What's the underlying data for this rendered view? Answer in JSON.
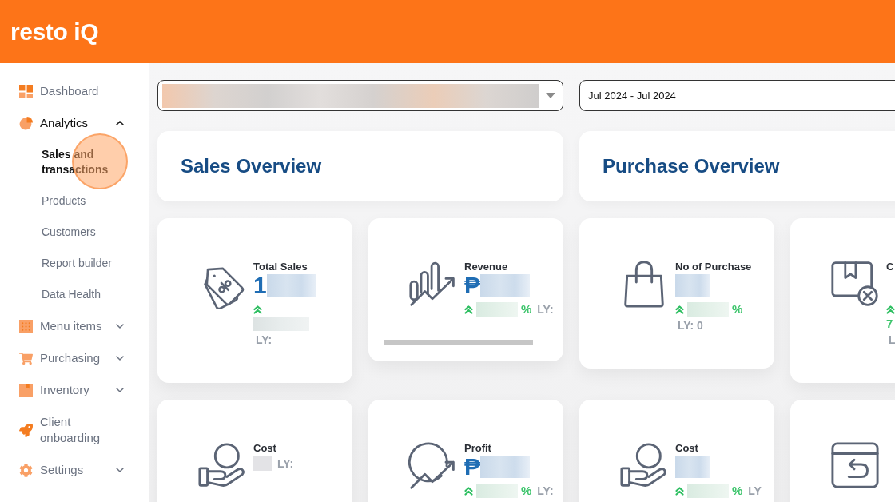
{
  "header": {
    "logo": "resto iQ"
  },
  "sidebar": {
    "items": [
      {
        "kind": "link",
        "label": "Dashboard",
        "selected": false
      },
      {
        "kind": "group",
        "label": "Analytics",
        "selected": true,
        "expanded": true,
        "children": [
          {
            "label": "Sales and transactions",
            "selected": true
          },
          {
            "label": "Products",
            "selected": false
          },
          {
            "label": "Customers",
            "selected": false
          },
          {
            "label": "Report builder",
            "selected": false
          },
          {
            "label": "Data Health",
            "selected": false
          }
        ]
      },
      {
        "kind": "group",
        "label": "Menu items",
        "selected": false,
        "expanded": false
      },
      {
        "kind": "group",
        "label": "Purchasing",
        "selected": false,
        "expanded": false
      },
      {
        "kind": "group",
        "label": "Inventory",
        "selected": false,
        "expanded": false
      },
      {
        "kind": "link",
        "label": "Client onboarding",
        "selected": false
      },
      {
        "kind": "group",
        "label": "Settings",
        "selected": false,
        "expanded": false
      }
    ]
  },
  "filters": {
    "store": {
      "redacted": true
    },
    "date_range": {
      "value": "Jul 2024 - Jul 2024"
    }
  },
  "sections": [
    {
      "title": "Sales Overview"
    },
    {
      "title": "Purchase Overview"
    }
  ],
  "kpi_cards": [
    {
      "title": "Total Sales",
      "scrollbar": false,
      "lines": [
        {
          "kind": "value",
          "text": "1",
          "blurred": true
        },
        {
          "kind": "change",
          "up": true,
          "blurred": false
        },
        {
          "kind": "percent",
          "blurred": true
        },
        {
          "kind": "ly",
          "text": "LY:",
          "blurred": false
        }
      ]
    },
    {
      "title": "Revenue",
      "scrollbar": true,
      "lines": [
        {
          "kind": "value",
          "text": "₱",
          "blurred": true
        },
        {
          "kind": "change",
          "up": true,
          "blurred": true,
          "text": "%",
          "ly": "LY:"
        }
      ]
    },
    {
      "title": "No of Purchase",
      "scrollbar": false,
      "lines": [
        {
          "kind": "value",
          "blurred": true
        },
        {
          "kind": "change",
          "up": true,
          "blurred": true,
          "text": "%"
        },
        {
          "kind": "ly",
          "text": "LY: 0",
          "blurred": false
        }
      ]
    },
    {
      "title": "C",
      "scrollbar": false,
      "lines": [
        {
          "kind": "value",
          "blurred": false
        },
        {
          "kind": "change",
          "up": true,
          "blurred": false
        },
        {
          "kind": "percent",
          "text": "7",
          "blurred": false
        },
        {
          "kind": "ly",
          "text": "L",
          "blurred": false
        }
      ]
    },
    {
      "title": "Cost",
      "scrollbar": false,
      "lines": [
        {
          "kind": "ly",
          "text": "LY:",
          "blurred": true
        }
      ]
    },
    {
      "title": "Profit",
      "scrollbar": false,
      "lines": [
        {
          "kind": "value",
          "text": "₱",
          "blurred": true
        },
        {
          "kind": "change",
          "up": true,
          "blurred": true,
          "text": "%",
          "ly": "LY:"
        }
      ]
    },
    {
      "title": "Cost",
      "scrollbar": false,
      "lines": [
        {
          "kind": "value",
          "blurred": true
        },
        {
          "kind": "change",
          "up": true,
          "blurred": true,
          "text": "%",
          "ly": "LY"
        }
      ]
    },
    {
      "scrollbar": false
    }
  ]
}
